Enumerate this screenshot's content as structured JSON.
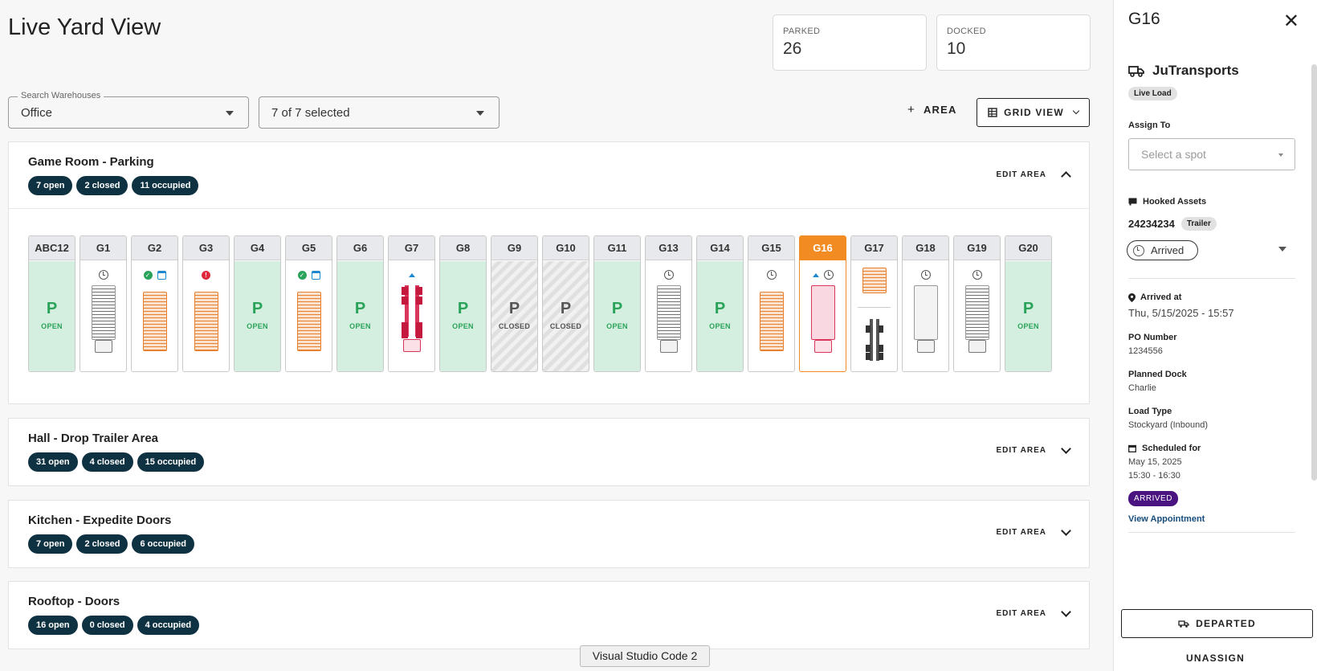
{
  "page": {
    "title": "Live Yard View"
  },
  "stats": [
    {
      "label": "PARKED",
      "value": "26"
    },
    {
      "label": "DOCKED",
      "value": "10"
    }
  ],
  "filters": {
    "warehouse_label": "Search Warehouses",
    "warehouse_value": "Office",
    "selection_value": "7 of 7 selected"
  },
  "toolbar": {
    "area_label": "AREA",
    "grid_view_label": "GRID VIEW"
  },
  "areas": [
    {
      "title": "Game Room - Parking",
      "open": "7 open",
      "closed": "2 closed",
      "occupied": "11 occupied",
      "edit": "EDIT AREA",
      "expanded": true
    },
    {
      "title": "Hall - Drop Trailer Area",
      "open": "31 open",
      "closed": "4 closed",
      "occupied": "15 occupied",
      "edit": "EDIT AREA",
      "expanded": false
    },
    {
      "title": "Kitchen - Expedite Doors",
      "open": "7 open",
      "closed": "2 closed",
      "occupied": "6 occupied",
      "edit": "EDIT AREA",
      "expanded": false
    },
    {
      "title": "Rooftop - Doors",
      "open": "16 open",
      "closed": "0 closed",
      "occupied": "4 occupied",
      "edit": "EDIT AREA",
      "expanded": false
    }
  ],
  "spots": [
    {
      "name": "ABC12",
      "state": "open",
      "p": "P",
      "label": "OPEN"
    },
    {
      "name": "G1",
      "state": "gray",
      "icons": [
        "clock-icon"
      ]
    },
    {
      "name": "G2",
      "state": "orange",
      "icons": [
        "check-icon",
        "calendar-icon"
      ]
    },
    {
      "name": "G3",
      "state": "orange",
      "icons": [
        "alert-icon"
      ]
    },
    {
      "name": "G4",
      "state": "open",
      "p": "P",
      "label": "OPEN"
    },
    {
      "name": "G5",
      "state": "orange",
      "icons": [
        "check-icon",
        "calendar-icon"
      ]
    },
    {
      "name": "G6",
      "state": "open",
      "p": "P",
      "label": "OPEN"
    },
    {
      "name": "G7",
      "state": "redtruck",
      "icons": [
        "arrow-up-icon"
      ]
    },
    {
      "name": "G8",
      "state": "open",
      "p": "P",
      "label": "OPEN"
    },
    {
      "name": "G9",
      "state": "closed",
      "p": "P",
      "label": "CLOSED"
    },
    {
      "name": "G10",
      "state": "closed",
      "p": "P",
      "label": "CLOSED"
    },
    {
      "name": "G11",
      "state": "open",
      "p": "P",
      "label": "OPEN"
    },
    {
      "name": "G13",
      "state": "gray",
      "icons": [
        "clock-icon"
      ]
    },
    {
      "name": "G14",
      "state": "open",
      "p": "P",
      "label": "OPEN"
    },
    {
      "name": "G15",
      "state": "orange",
      "icons": [
        "clock-icon"
      ]
    },
    {
      "name": "G16",
      "state": "pink",
      "selected": true,
      "icons": [
        "arrow-up-icon",
        "clock-icon"
      ]
    },
    {
      "name": "G17",
      "state": "double"
    },
    {
      "name": "G18",
      "state": "plain",
      "icons": [
        "clock-icon"
      ]
    },
    {
      "name": "G19",
      "state": "gray",
      "icons": [
        "clock-icon"
      ]
    },
    {
      "name": "G20",
      "state": "open",
      "p": "P",
      "label": "OPEN"
    }
  ],
  "panel": {
    "title": "G16",
    "carrier": "JuTransports",
    "load_chip": "Live Load",
    "assign_label": "Assign To",
    "assign_placeholder": "Select a spot",
    "hooked_label": "Hooked Assets",
    "asset_id": "24234234",
    "asset_chip": "Trailer",
    "status": "Arrived",
    "arrived_at_label": "Arrived at",
    "arrived_at_value": "Thu, 5/15/2025 - 15:57",
    "po_label": "PO Number",
    "po_value": "1234556",
    "dock_label": "Planned Dock",
    "dock_value": "Charlie",
    "load_type_label": "Load Type",
    "load_type_value": "Stockyard (Inbound)",
    "scheduled_label": "Scheduled for",
    "scheduled_date": "May 15, 2025",
    "scheduled_time": "15:30 - 16:30",
    "badge": "ARRIVED",
    "view_appt": "View Appointment",
    "departed": "DEPARTED",
    "unassign": "UNASSIGN"
  },
  "tooltip": "Visual Studio Code 2",
  "colors": {
    "primary": "#0f3242",
    "selected": "#f28b22",
    "open_spot": "#d4efdf",
    "arrived_badge": "#4a1480",
    "link": "#164d7d"
  }
}
